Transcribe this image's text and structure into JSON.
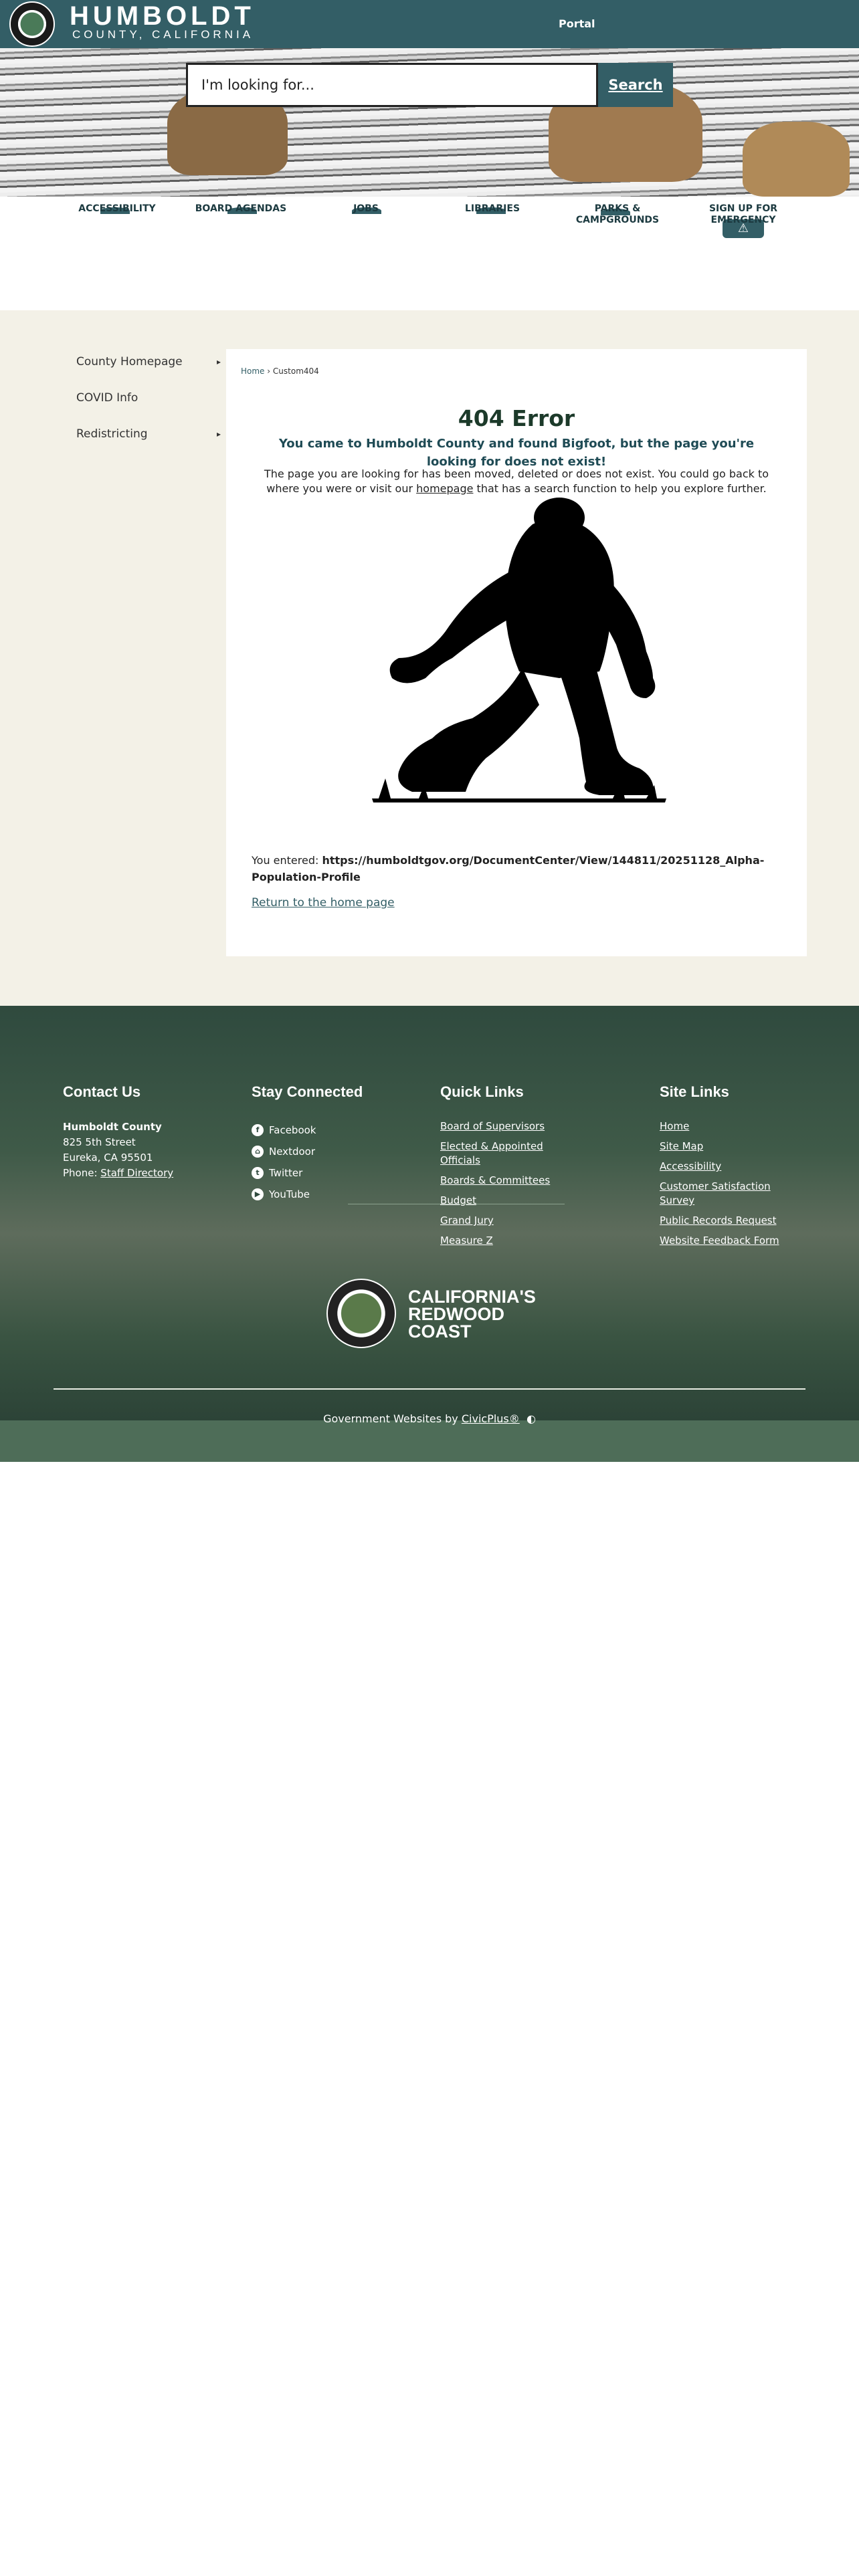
{
  "header": {
    "logo_name": "HUMBOLDT",
    "logo_sub": "COUNTY, CALIFORNIA",
    "portal_label": "Portal",
    "brand_color": "#335e66"
  },
  "search": {
    "placeholder": "I'm looking for...",
    "button_label": "Search"
  },
  "quicklinks": [
    {
      "label": "ACCESSIBILITY"
    },
    {
      "label": "BOARD AGENDAS"
    },
    {
      "label": "JOBS"
    },
    {
      "label": "LIBRARIES"
    },
    {
      "label": "PARKS & CAMPGROUNDS"
    },
    {
      "label": "SIGN UP FOR EMERGENCY"
    }
  ],
  "sidebar": {
    "items": [
      {
        "label": "County Homepage",
        "arrow": "▸"
      },
      {
        "label": "COVID Info",
        "arrow": ""
      },
      {
        "label": "Redistricting",
        "arrow": "▸"
      }
    ]
  },
  "breadcrumb": {
    "home": "Home",
    "separator": "›",
    "current": "Custom404"
  },
  "error": {
    "title": "404 Error",
    "subtitle": "You came to Humboldt County and found Bigfoot, but the page you're looking for does not exist!",
    "body_before": "The page you are looking for has been moved, deleted or does not exist. You could go back to where you were or visit our ",
    "body_link": "homepage",
    "body_after": " that has a search function to help you explore further.",
    "entered_label": "You entered: ",
    "entered_url": "https://humboldtgov.org/DocumentCenter/View/144811/20251128_Alpha-Population-Profile",
    "return_link": "Return to the home page"
  },
  "footer": {
    "contact": {
      "heading": "Contact Us",
      "org": "Humboldt County",
      "street": "825 5th Street",
      "city": "Eureka, CA 95501",
      "phone_label": "Phone: ",
      "phone_link": "Staff Directory"
    },
    "stay_connected": {
      "heading": "Stay Connected",
      "items": [
        {
          "label": "Facebook",
          "icon": "facebook-icon"
        },
        {
          "label": "Nextdoor",
          "icon": "nextdoor-icon"
        },
        {
          "label": "Twitter",
          "icon": "twitter-icon"
        },
        {
          "label": "YouTube",
          "icon": "youtube-icon"
        }
      ]
    },
    "quick_links": {
      "heading": "Quick Links",
      "items": [
        "Board of Supervisors",
        "Elected & Appointed Officials",
        "Boards & Committees",
        "Budget",
        "Grand Jury",
        "Measure Z"
      ]
    },
    "site_links": {
      "heading": "Site Links",
      "items": [
        "Home",
        "Site Map",
        "Accessibility",
        "Customer Satisfaction Survey",
        "Public Records Request",
        "Website Feedback Form"
      ]
    },
    "brand_lines": [
      "CALIFORNIA'S",
      "REDWOOD",
      "COAST"
    ],
    "credit_prefix": "Government Websites by ",
    "credit_link": "CivicPlus®"
  }
}
